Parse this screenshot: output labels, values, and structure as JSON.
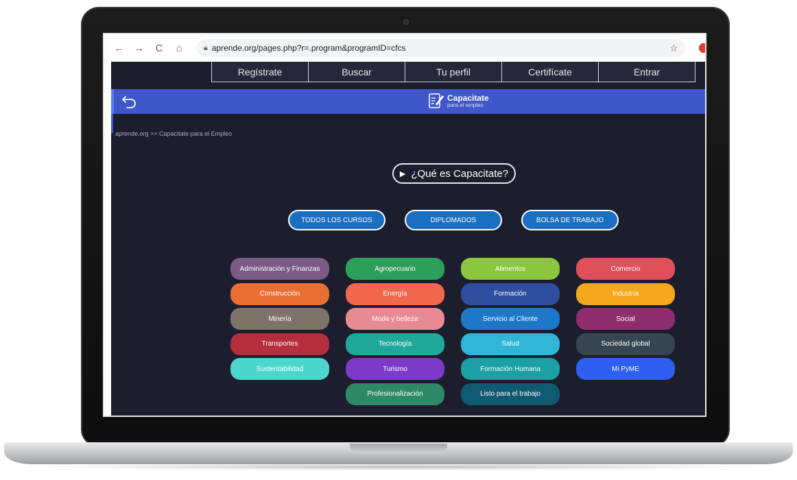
{
  "browser": {
    "url": "aprende.org/pages.php?r=.program&programID=cfcs"
  },
  "topnav": [
    "Regístrate",
    "Buscar",
    "Tu perfil",
    "Certifícate",
    "Entrar"
  ],
  "banner": {
    "logo_title": "Capacitate",
    "logo_subtitle": "para el empleo"
  },
  "breadcrumb": "aprende.org >> Capacitate para el Empleo",
  "what_button": "¿Qué es Capacitate?",
  "main_buttons": [
    "TODOS LOS CURSOS",
    "DIPLOMADOS",
    "BOLSA DE TRABAJO"
  ],
  "categories": [
    {
      "label": "Administración y Finanzas",
      "color": "#7b5a86"
    },
    {
      "label": "Agropecuario",
      "color": "#2e9e5b"
    },
    {
      "label": "Alimentos",
      "color": "#8cc63f"
    },
    {
      "label": "Comercio",
      "color": "#e0505b"
    },
    {
      "label": "Construcción",
      "color": "#e86e34"
    },
    {
      "label": "Energía",
      "color": "#f2684e"
    },
    {
      "label": "Formación",
      "color": "#2f4f9e"
    },
    {
      "label": "Industria",
      "color": "#f4a71c"
    },
    {
      "label": "Minería",
      "color": "#7d7369"
    },
    {
      "label": "Moda y belleza",
      "color": "#e88a93"
    },
    {
      "label": "Servicio al Cliente",
      "color": "#1e78c8"
    },
    {
      "label": "Social",
      "color": "#8e2e6c"
    },
    {
      "label": "Transportes",
      "color": "#b52e3e"
    },
    {
      "label": "Tecnología",
      "color": "#1fa99b"
    },
    {
      "label": "Salud",
      "color": "#2fb5d6"
    },
    {
      "label": "Sociedad global",
      "color": "#36454f"
    },
    {
      "label": "Sustentabilidad",
      "color": "#4fd6cc"
    },
    {
      "label": "Turismo",
      "color": "#7b3bc8"
    },
    {
      "label": "Formación Humana",
      "color": "#1aa0a5"
    },
    {
      "label": "Mi PyME",
      "color": "#2e5ff0"
    },
    {
      "label": "Profesionalización",
      "color": "#2e8a66"
    },
    {
      "label": "Listo para el trabajo",
      "color": "#0f5a72"
    }
  ]
}
